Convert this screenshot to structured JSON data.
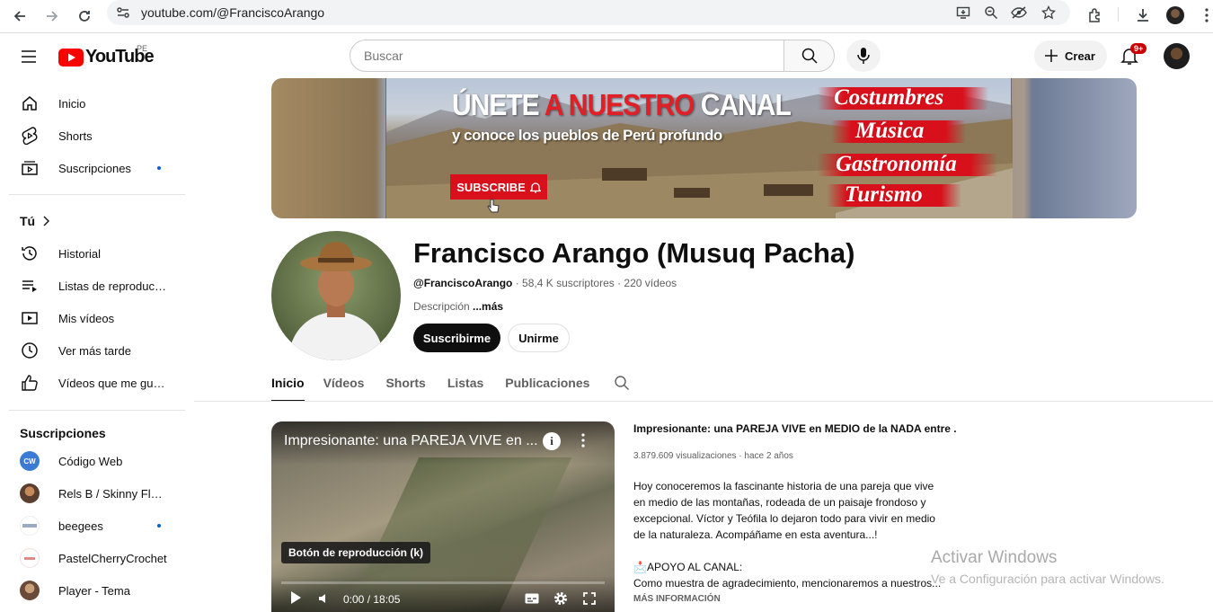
{
  "browser": {
    "url": "youtube.com/@FranciscoArango"
  },
  "yt": {
    "logo_text": "YouTube",
    "country": "PE",
    "search_placeholder": "Buscar",
    "create_label": "Crear",
    "notif_badge": "9+"
  },
  "sidebar": {
    "main": [
      {
        "label": "Inicio",
        "icon": "home-icon"
      },
      {
        "label": "Shorts",
        "icon": "shorts-icon"
      },
      {
        "label": "Suscripciones",
        "icon": "subscriptions-icon"
      }
    ],
    "you_heading": "Tú",
    "you": [
      {
        "label": "Historial",
        "icon": "history-icon"
      },
      {
        "label": "Listas de reproducc...",
        "icon": "playlists-icon"
      },
      {
        "label": "Mis vídeos",
        "icon": "my-videos-icon"
      },
      {
        "label": "Ver más tarde",
        "icon": "watch-later-icon"
      },
      {
        "label": "Vídeos que me gus...",
        "icon": "liked-icon"
      }
    ],
    "subs_heading": "Suscripciones",
    "subs": [
      {
        "label": "Código Web",
        "avatar": "CW",
        "color": "#3b7bd6"
      },
      {
        "label": "Rels B / Skinny Flakk",
        "avatar": "",
        "color": "#7a5a48"
      },
      {
        "label": "beegees",
        "avatar": "",
        "color": "#9aa9c4"
      },
      {
        "label": "PastelCherryCrochet",
        "avatar": "",
        "color": "#e7a6a6"
      },
      {
        "label": "Player - Tema",
        "avatar": "",
        "color": "#8a6a55"
      }
    ]
  },
  "banner": {
    "title_a": "ÚNETE ",
    "title_b": "A NUESTRO",
    "title_c": " CANAL",
    "subtitle": "y conoce los pueblos de Perú profundo",
    "subscribe": "SUBSCRIBE",
    "tags": [
      "Costumbres",
      "Música",
      "Gastronomía",
      "Turismo"
    ]
  },
  "channel": {
    "name": "Francisco Arango (Musuq Pacha)",
    "handle": "@FranciscoArango",
    "stats": " · 58,4 K suscriptores · 220 vídeos",
    "desc_label": "Descripción",
    "desc_more": " ...más",
    "subscribe": "Suscribirme",
    "join": "Unirme"
  },
  "tabs": [
    "Inicio",
    "Vídeos",
    "Shorts",
    "Listas",
    "Publicaciones"
  ],
  "player": {
    "title": "Impresionante: una PAREJA VIVE en ...",
    "info": "i",
    "tooltip": "Botón de reproducción (k)",
    "time": "0:00 / 18:05",
    "progress": 0
  },
  "video": {
    "title": "Impresionante: una PAREJA VIVE en MEDIO de la NADA entre ...",
    "meta": "3.879.609 visualizaciones · hace 2 años",
    "desc_lines": [
      "Hoy conoceremos la fascinante historia de una pareja que vive",
      "en medio de las montañas, rodeada de un paisaje frondoso y",
      "excepcional. Víctor y Teófila lo dejaron todo para vivir en medio",
      "de la naturaleza. Acompáñame en esta aventura...!"
    ],
    "support": "📩APOYO AL CANAL:",
    "support_line": "Como muestra de agradecimiento, mencionaremos a nuestros...",
    "more": "MÁS INFORMACIÓN"
  },
  "watermark": {
    "line1": "Activar Windows",
    "line2": "Ve a Configuración para activar Windows."
  }
}
